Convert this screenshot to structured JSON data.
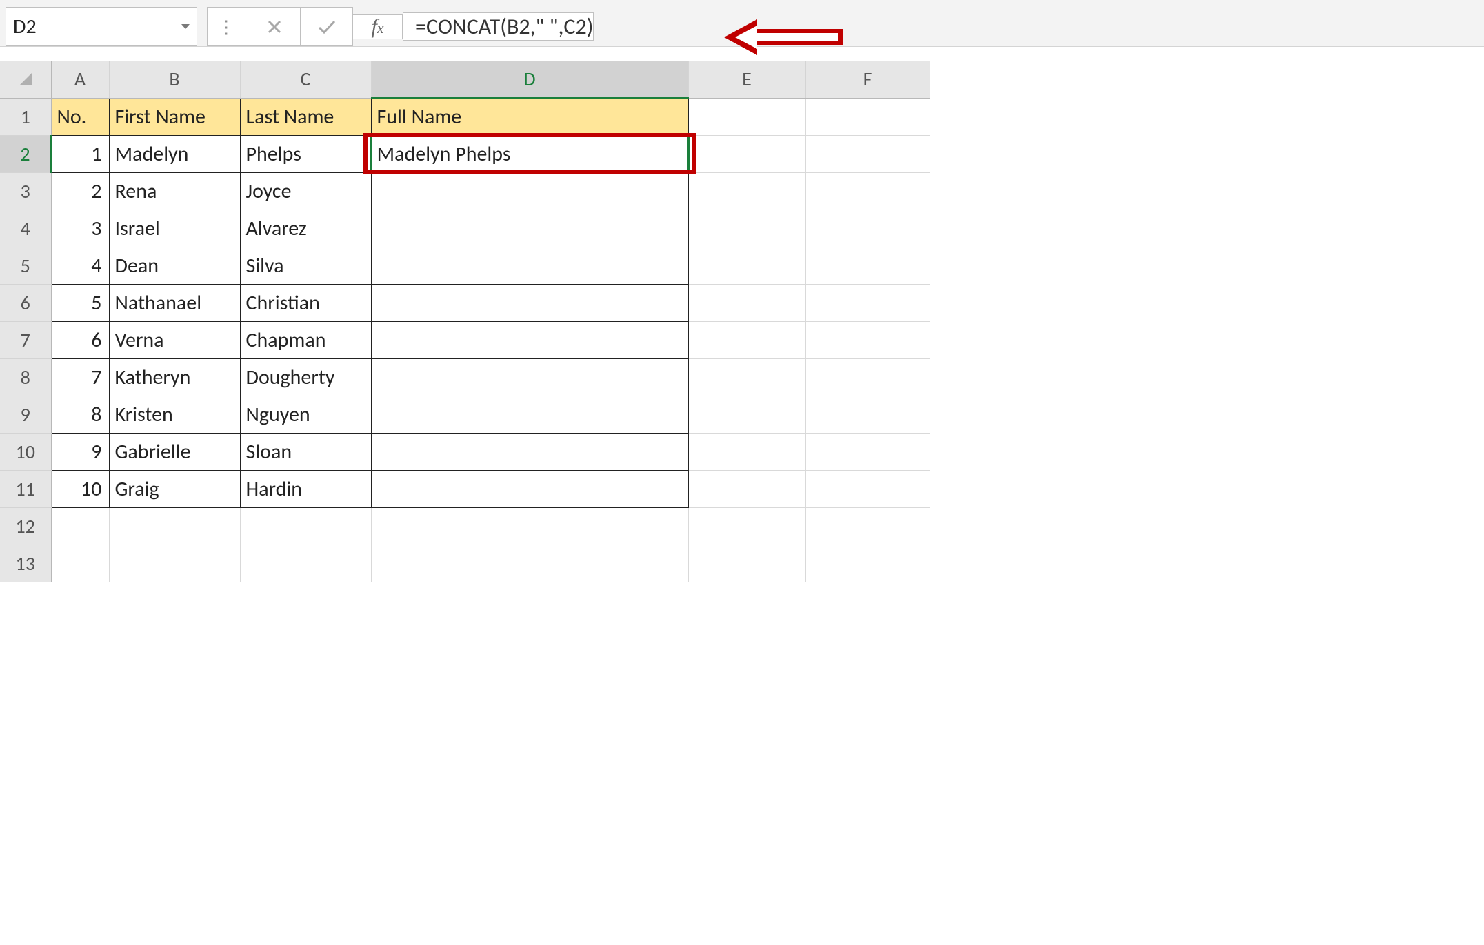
{
  "nameBox": "D2",
  "formula": "=CONCAT(B2,\" \",C2)",
  "columnHeaders": [
    "A",
    "B",
    "C",
    "D",
    "E",
    "F"
  ],
  "rowHeaders": [
    "1",
    "2",
    "3",
    "4",
    "5",
    "6",
    "7",
    "8",
    "9",
    "10",
    "11",
    "12",
    "13"
  ],
  "selectedColumnIndex": 3,
  "selectedRowIndex": 1,
  "table": {
    "headers": {
      "no": "No.",
      "first": "First Name",
      "last": "Last Name",
      "full": "Full Name"
    },
    "rows": [
      {
        "no": "1",
        "first": "Madelyn",
        "last": "Phelps",
        "full": "Madelyn Phelps"
      },
      {
        "no": "2",
        "first": "Rena",
        "last": "Joyce",
        "full": ""
      },
      {
        "no": "3",
        "first": "Israel",
        "last": "Alvarez",
        "full": ""
      },
      {
        "no": "4",
        "first": "Dean",
        "last": "Silva",
        "full": ""
      },
      {
        "no": "5",
        "first": "Nathanael",
        "last": "Christian",
        "full": ""
      },
      {
        "no": "6",
        "first": "Verna",
        "last": "Chapman",
        "full": ""
      },
      {
        "no": "7",
        "first": "Katheryn",
        "last": "Dougherty",
        "full": ""
      },
      {
        "no": "8",
        "first": "Kristen",
        "last": "Nguyen",
        "full": ""
      },
      {
        "no": "9",
        "first": "Gabrielle",
        "last": "Sloan",
        "full": ""
      },
      {
        "no": "10",
        "first": "Graig",
        "last": "Hardin",
        "full": ""
      }
    ]
  }
}
